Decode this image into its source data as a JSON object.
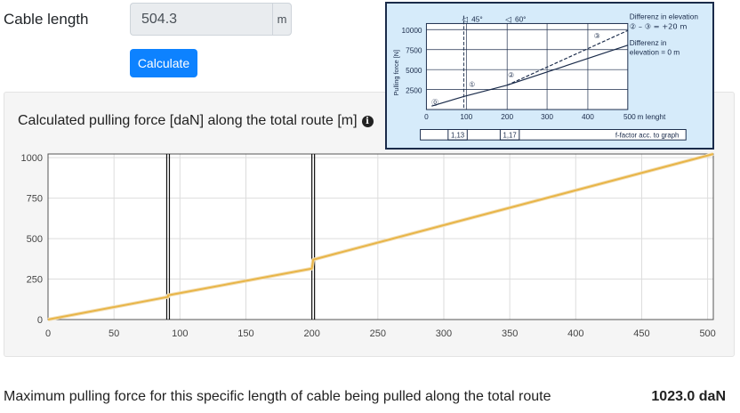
{
  "form": {
    "cable_length_label": "Cable length",
    "cable_length_value": "504.3",
    "unit": "m",
    "calculate_button": "Calculate"
  },
  "result": {
    "title": "Calculated pulling force [daN] along the total route [m]",
    "max_label": "Maximum pulling force for this specific length of cable being pulled along the total route",
    "max_value": "1023.0 daN"
  },
  "reference": {
    "ylabel": "Pulling force [N]",
    "y_ticks": [
      "10000",
      "7500",
      "5000",
      "2500"
    ],
    "x_ticks": [
      "0",
      "100",
      "200",
      "300",
      "400",
      "500"
    ],
    "x_unit": "m lenght",
    "angle_1": "45°",
    "angle_2": "60°",
    "legend_1": "Differenz in elevation",
    "legend_2": "② – ③ = +20 m",
    "legend_3": "Differenz in",
    "legend_4": "elevation = 0 m",
    "factor_1": "1,13",
    "factor_2": "1,17",
    "factor_caption": "f-factor acc. to graph",
    "markers": [
      "⓪",
      "①",
      "②",
      "③"
    ]
  },
  "colors": {
    "line": "#e8b548",
    "button": "#0d82ff",
    "panel": "#d6ebfa"
  },
  "chart_data": {
    "type": "line",
    "title": "",
    "xlabel": "",
    "ylabel": "",
    "xlim": [
      0,
      504.3
    ],
    "ylim": [
      0,
      1023
    ],
    "x_ticks": [
      0,
      50,
      100,
      150,
      200,
      250,
      300,
      350,
      400,
      450,
      500
    ],
    "y_ticks": [
      0,
      250,
      500,
      750,
      1000
    ],
    "series": [
      {
        "x": [
          0,
          91,
          91,
          200,
          201,
          504.3
        ],
        "y": [
          0,
          140,
          150,
          315,
          370,
          1023
        ]
      }
    ],
    "markers_x": [
      91,
      201
    ],
    "grid": true
  }
}
